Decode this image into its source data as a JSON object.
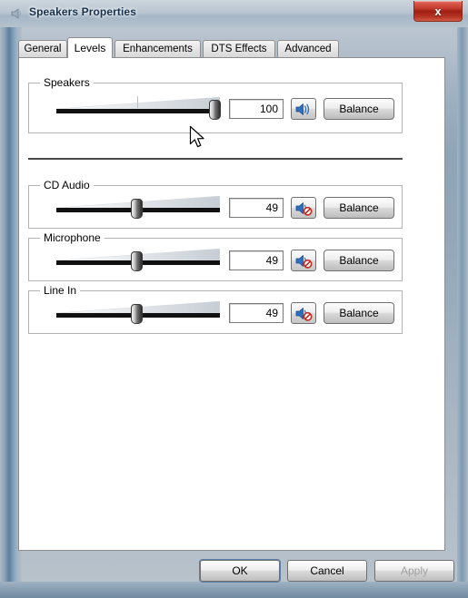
{
  "window": {
    "title": "Speakers Properties",
    "icon": "speaker-properties-icon",
    "close_label": "x"
  },
  "tabs": [
    {
      "label": "General",
      "active": false
    },
    {
      "label": "Levels",
      "active": true
    },
    {
      "label": "Enhancements",
      "active": false
    },
    {
      "label": "DTS Effects",
      "active": false
    },
    {
      "label": "Advanced",
      "active": false
    }
  ],
  "levels": {
    "groups": [
      {
        "title": "Speakers",
        "value": "100",
        "slider_percent": 100,
        "muted": false,
        "mute_icon": "speaker-on-icon",
        "balance_label": "Balance"
      },
      {
        "title": "CD Audio",
        "value": "49",
        "slider_percent": 49,
        "muted": true,
        "mute_icon": "speaker-muted-icon",
        "balance_label": "Balance"
      },
      {
        "title": "Microphone",
        "value": "49",
        "slider_percent": 49,
        "muted": true,
        "mute_icon": "speaker-muted-icon",
        "balance_label": "Balance"
      },
      {
        "title": "Line In",
        "value": "49",
        "slider_percent": 49,
        "muted": true,
        "mute_icon": "speaker-muted-icon",
        "balance_label": "Balance"
      }
    ]
  },
  "footer": {
    "ok_label": "OK",
    "cancel_label": "Cancel",
    "apply_label": "Apply",
    "apply_disabled": true
  },
  "colors": {
    "title_text": "#17324d",
    "close_red": "#9e1f12",
    "track_black": "#111111",
    "speaker_blue": "#2f6fbc",
    "mute_red": "#c32a22",
    "panel_white": "#ffffff",
    "frame_blue": "#7f9bb2"
  }
}
